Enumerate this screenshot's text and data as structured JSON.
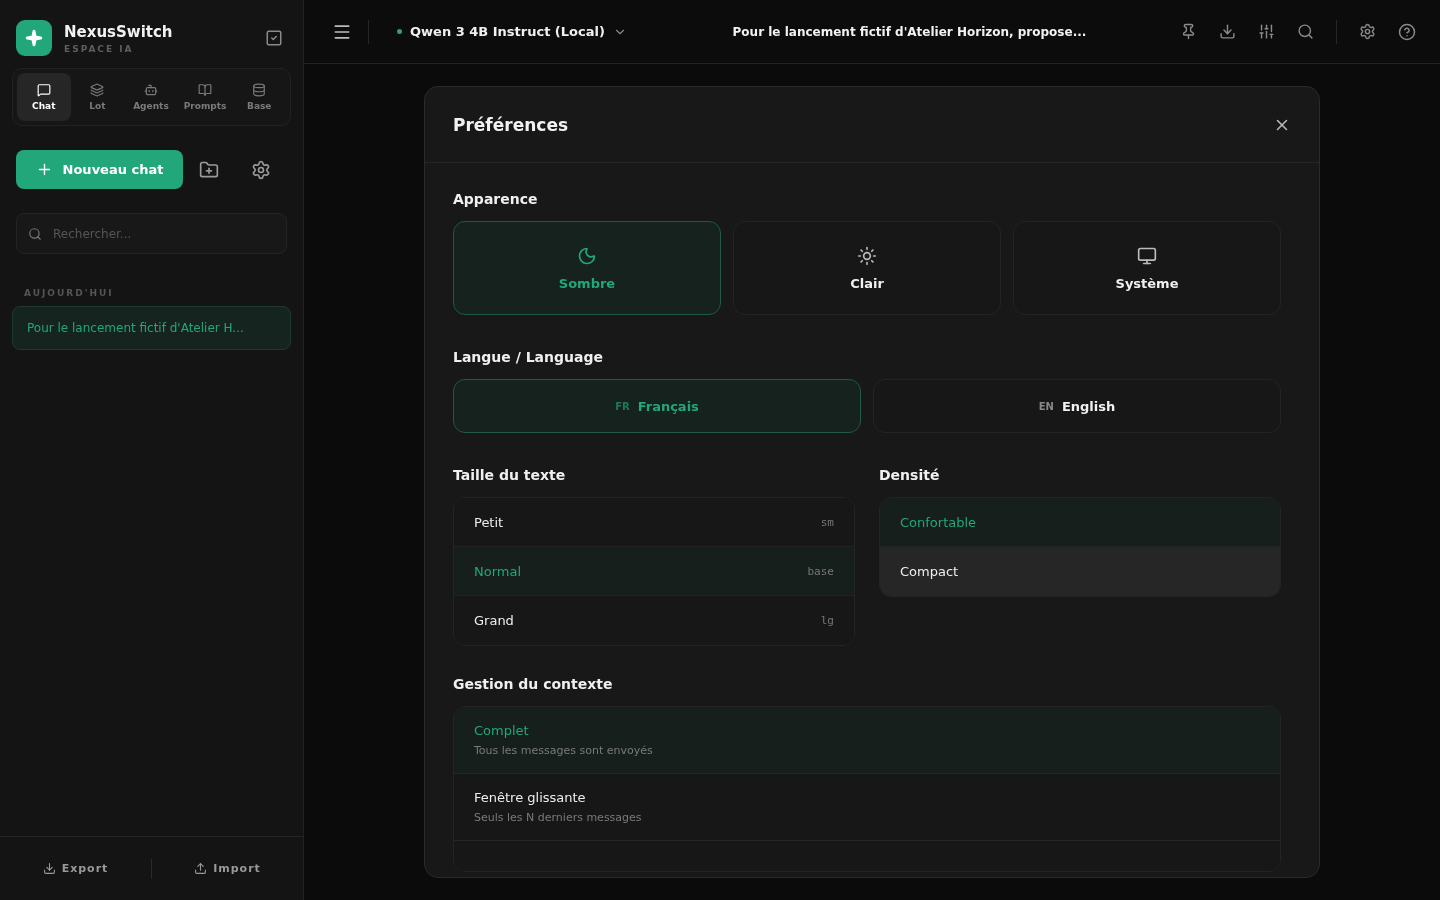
{
  "sidebar": {
    "brand": {
      "name": "NexusSwitch",
      "subtitle": "ESPACE IA"
    },
    "nav": [
      {
        "label": "Chat",
        "selected": true
      },
      {
        "label": "Lot",
        "selected": false
      },
      {
        "label": "Agents",
        "selected": false
      },
      {
        "label": "Prompts",
        "selected": false
      },
      {
        "label": "Base",
        "selected": false
      }
    ],
    "new_chat": "Nouveau chat",
    "search": {
      "placeholder": "Rechercher..."
    },
    "group_label": "AUJOURD'HUI",
    "conversations": [
      {
        "title": "Pour le lancement fictif d'Atelier H...",
        "selected": true
      }
    ],
    "footer": [
      "Export",
      "Import"
    ]
  },
  "topbar": {
    "model": "Qwen 3 4B Instruct (Local)",
    "model_online": true,
    "title": "Pour le lancement fictif d'Atelier Horizon, propose..."
  },
  "dialog": {
    "title": "Préférences",
    "appearance": {
      "label": "Apparence",
      "options": [
        {
          "label": "Sombre",
          "selected": true
        },
        {
          "label": "Clair",
          "selected": false
        },
        {
          "label": "Système",
          "selected": false
        }
      ]
    },
    "language": {
      "label": "Langue / Language",
      "options": [
        {
          "code": "FR",
          "label": "Français",
          "selected": true
        },
        {
          "code": "EN",
          "label": "English",
          "selected": false
        }
      ]
    },
    "text_size": {
      "label": "Taille du texte",
      "options": [
        {
          "label": "Petit",
          "tag": "sm",
          "selected": false
        },
        {
          "label": "Normal",
          "tag": "base",
          "selected": true
        },
        {
          "label": "Grand",
          "tag": "lg",
          "selected": false
        }
      ]
    },
    "density": {
      "label": "Densité",
      "options": [
        {
          "label": "Confortable",
          "selected": true,
          "hovered": false
        },
        {
          "label": "Compact",
          "selected": false,
          "hovered": true
        }
      ]
    },
    "context": {
      "label": "Gestion du contexte",
      "options": [
        {
          "label": "Complet",
          "description": "Tous les messages sont envoyés",
          "selected": true
        },
        {
          "label": "Fenêtre glissante",
          "description": "Seuls les N derniers messages",
          "selected": false
        }
      ]
    }
  }
}
